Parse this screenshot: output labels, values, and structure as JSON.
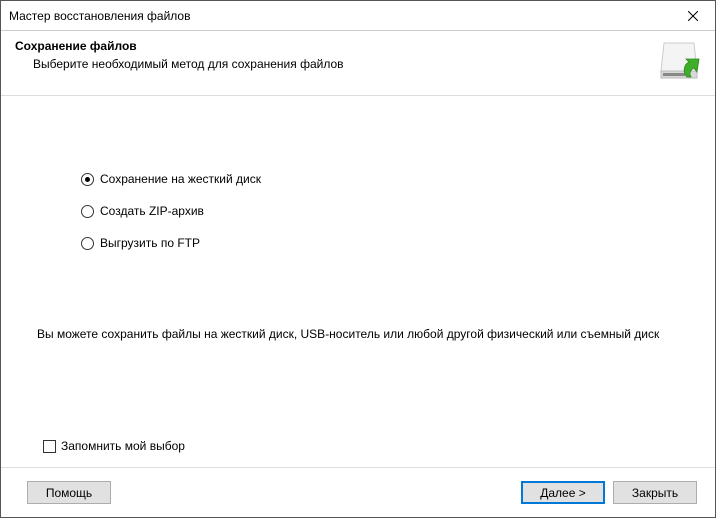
{
  "window": {
    "title": "Мастер восстановления файлов"
  },
  "header": {
    "title": "Сохранение файлов",
    "subtitle": "Выберите необходимый метод для сохранения файлов"
  },
  "options": [
    {
      "label": "Сохранение на жесткий диск",
      "selected": true
    },
    {
      "label": "Создать ZIP-архив",
      "selected": false
    },
    {
      "label": "Выгрузить по FTP",
      "selected": false
    }
  ],
  "description": "Вы можете сохранить файлы на жесткий диск, USB-носитель или любой другой физический или съемный диск",
  "remember": {
    "label": "Запомнить мой выбор",
    "checked": false
  },
  "buttons": {
    "help": "Помощь",
    "next": "Далее >",
    "close": "Закрыть"
  }
}
